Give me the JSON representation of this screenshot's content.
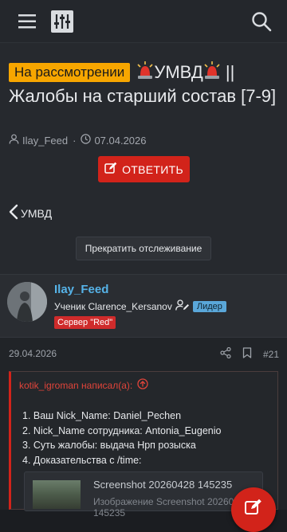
{
  "topbar": {
    "icons": [
      "menu-icon",
      "filter-sliders-icon",
      "search-icon"
    ]
  },
  "thread": {
    "prefix": "На рассмотрении",
    "title_part1": "УМВД",
    "title_part2": "|| Жалобы на старший состав [7-9]",
    "author": "Ilay_Feed",
    "date": "07.04.2026",
    "reply_label": "ОТВЕТИТЬ",
    "back_label": "УМВД",
    "unwatch_label": "Прекратить отслеживание"
  },
  "post": {
    "username": "Ilay_Feed",
    "user_title": "Ученик Clarence_Kersanov",
    "leader_badge": "Лидер",
    "server_badge": "Сервер \"Red\"",
    "date": "29.04.2026",
    "number": "#21",
    "quote_author": "kotik_igroman написал(а):",
    "lines": [
      "1. Ваш Nick_Name: Daniel_Pechen",
      "2. Nick_Name сотрудника: Antonia_Eugenio",
      "3. Суть жалобы: выдача Нрп розыска",
      "4. Доказательства с /time:"
    ],
    "attachment_name": "Screenshot 20260428 145235",
    "attachment_sub": "Изображение Screenshot 20260428 145235"
  },
  "colors": {
    "accent_red": "#d2231a",
    "prefix_orange": "#f7a600",
    "username_blue": "#56b3e8",
    "leader_badge": "#5aa7d9"
  }
}
